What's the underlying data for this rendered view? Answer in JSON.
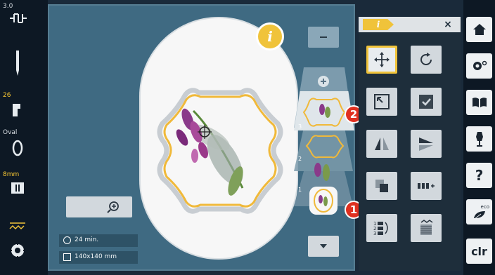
{
  "status_bar": {
    "version": "3.0",
    "needle_count": "26",
    "hoop_label": "Oval",
    "needle_size": "8mm"
  },
  "embroidery": {
    "time": "24 min.",
    "size": "140x140 mm"
  },
  "callouts": {
    "one": "1",
    "two": "2"
  },
  "layers": {
    "labels": [
      "3",
      "2",
      "1"
    ]
  },
  "right_panel": {
    "close_label": "×",
    "info_label": "i"
  },
  "side_buttons": {
    "help_label": "?",
    "eco_label": "eco",
    "clr_label": "clr"
  },
  "icons": [
    "home-icon",
    "settings-icon",
    "book-icon",
    "dress-form-icon",
    "help-icon",
    "eco-icon",
    "clear-icon",
    "move-icon",
    "rotate-icon",
    "resize-icon",
    "check-icon",
    "mirror-horizontal-icon",
    "mirror-vertical-icon",
    "duplicate-icon",
    "spacing-icon",
    "layer-order-icon",
    "stitch-fill-icon",
    "zoom-icon",
    "info-icon"
  ],
  "colors": {
    "accent": "#f0c33a",
    "callout": "#e03020",
    "main_bg": "#3f6a82"
  }
}
